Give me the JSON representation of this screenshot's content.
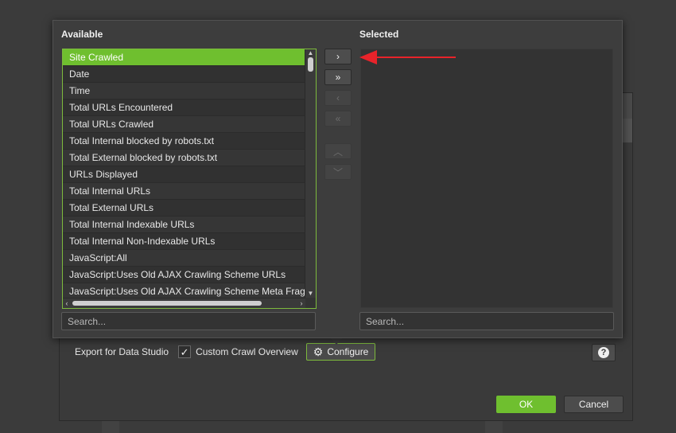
{
  "popup": {
    "available_title": "Available",
    "selected_title": "Selected",
    "available_items": [
      "Site Crawled",
      "Date",
      "Time",
      "Total URLs Encountered",
      "Total URLs Crawled",
      "Total Internal blocked by robots.txt",
      "Total External blocked by robots.txt",
      "URLs Displayed",
      "Total Internal URLs",
      "Total External URLs",
      "Total Internal Indexable URLs",
      "Total Internal Non-Indexable URLs",
      "JavaScript:All",
      "JavaScript:Uses Old AJAX Crawling Scheme URLs",
      "JavaScript:Uses Old AJAX Crawling Scheme Meta Fragment Tag"
    ],
    "selected_index": 0,
    "selected_items": [],
    "move_buttons": {
      "add": "›",
      "add_all": "»",
      "remove": "‹",
      "remove_all": "«",
      "move_up": "︿",
      "move_down": "﹀"
    },
    "search_available_placeholder": "Search...",
    "search_selected_placeholder": "Search..."
  },
  "dialog": {
    "export_label": "Export for Data Studio",
    "checkbox_checked": true,
    "checkbox_label": "Custom Crawl Overview",
    "configure_label": "Configure",
    "help_icon": "question-icon",
    "ok_label": "OK",
    "cancel_label": "Cancel"
  },
  "colors": {
    "accent": "#6fbf2f",
    "annotation_arrow": "#e8232a"
  }
}
